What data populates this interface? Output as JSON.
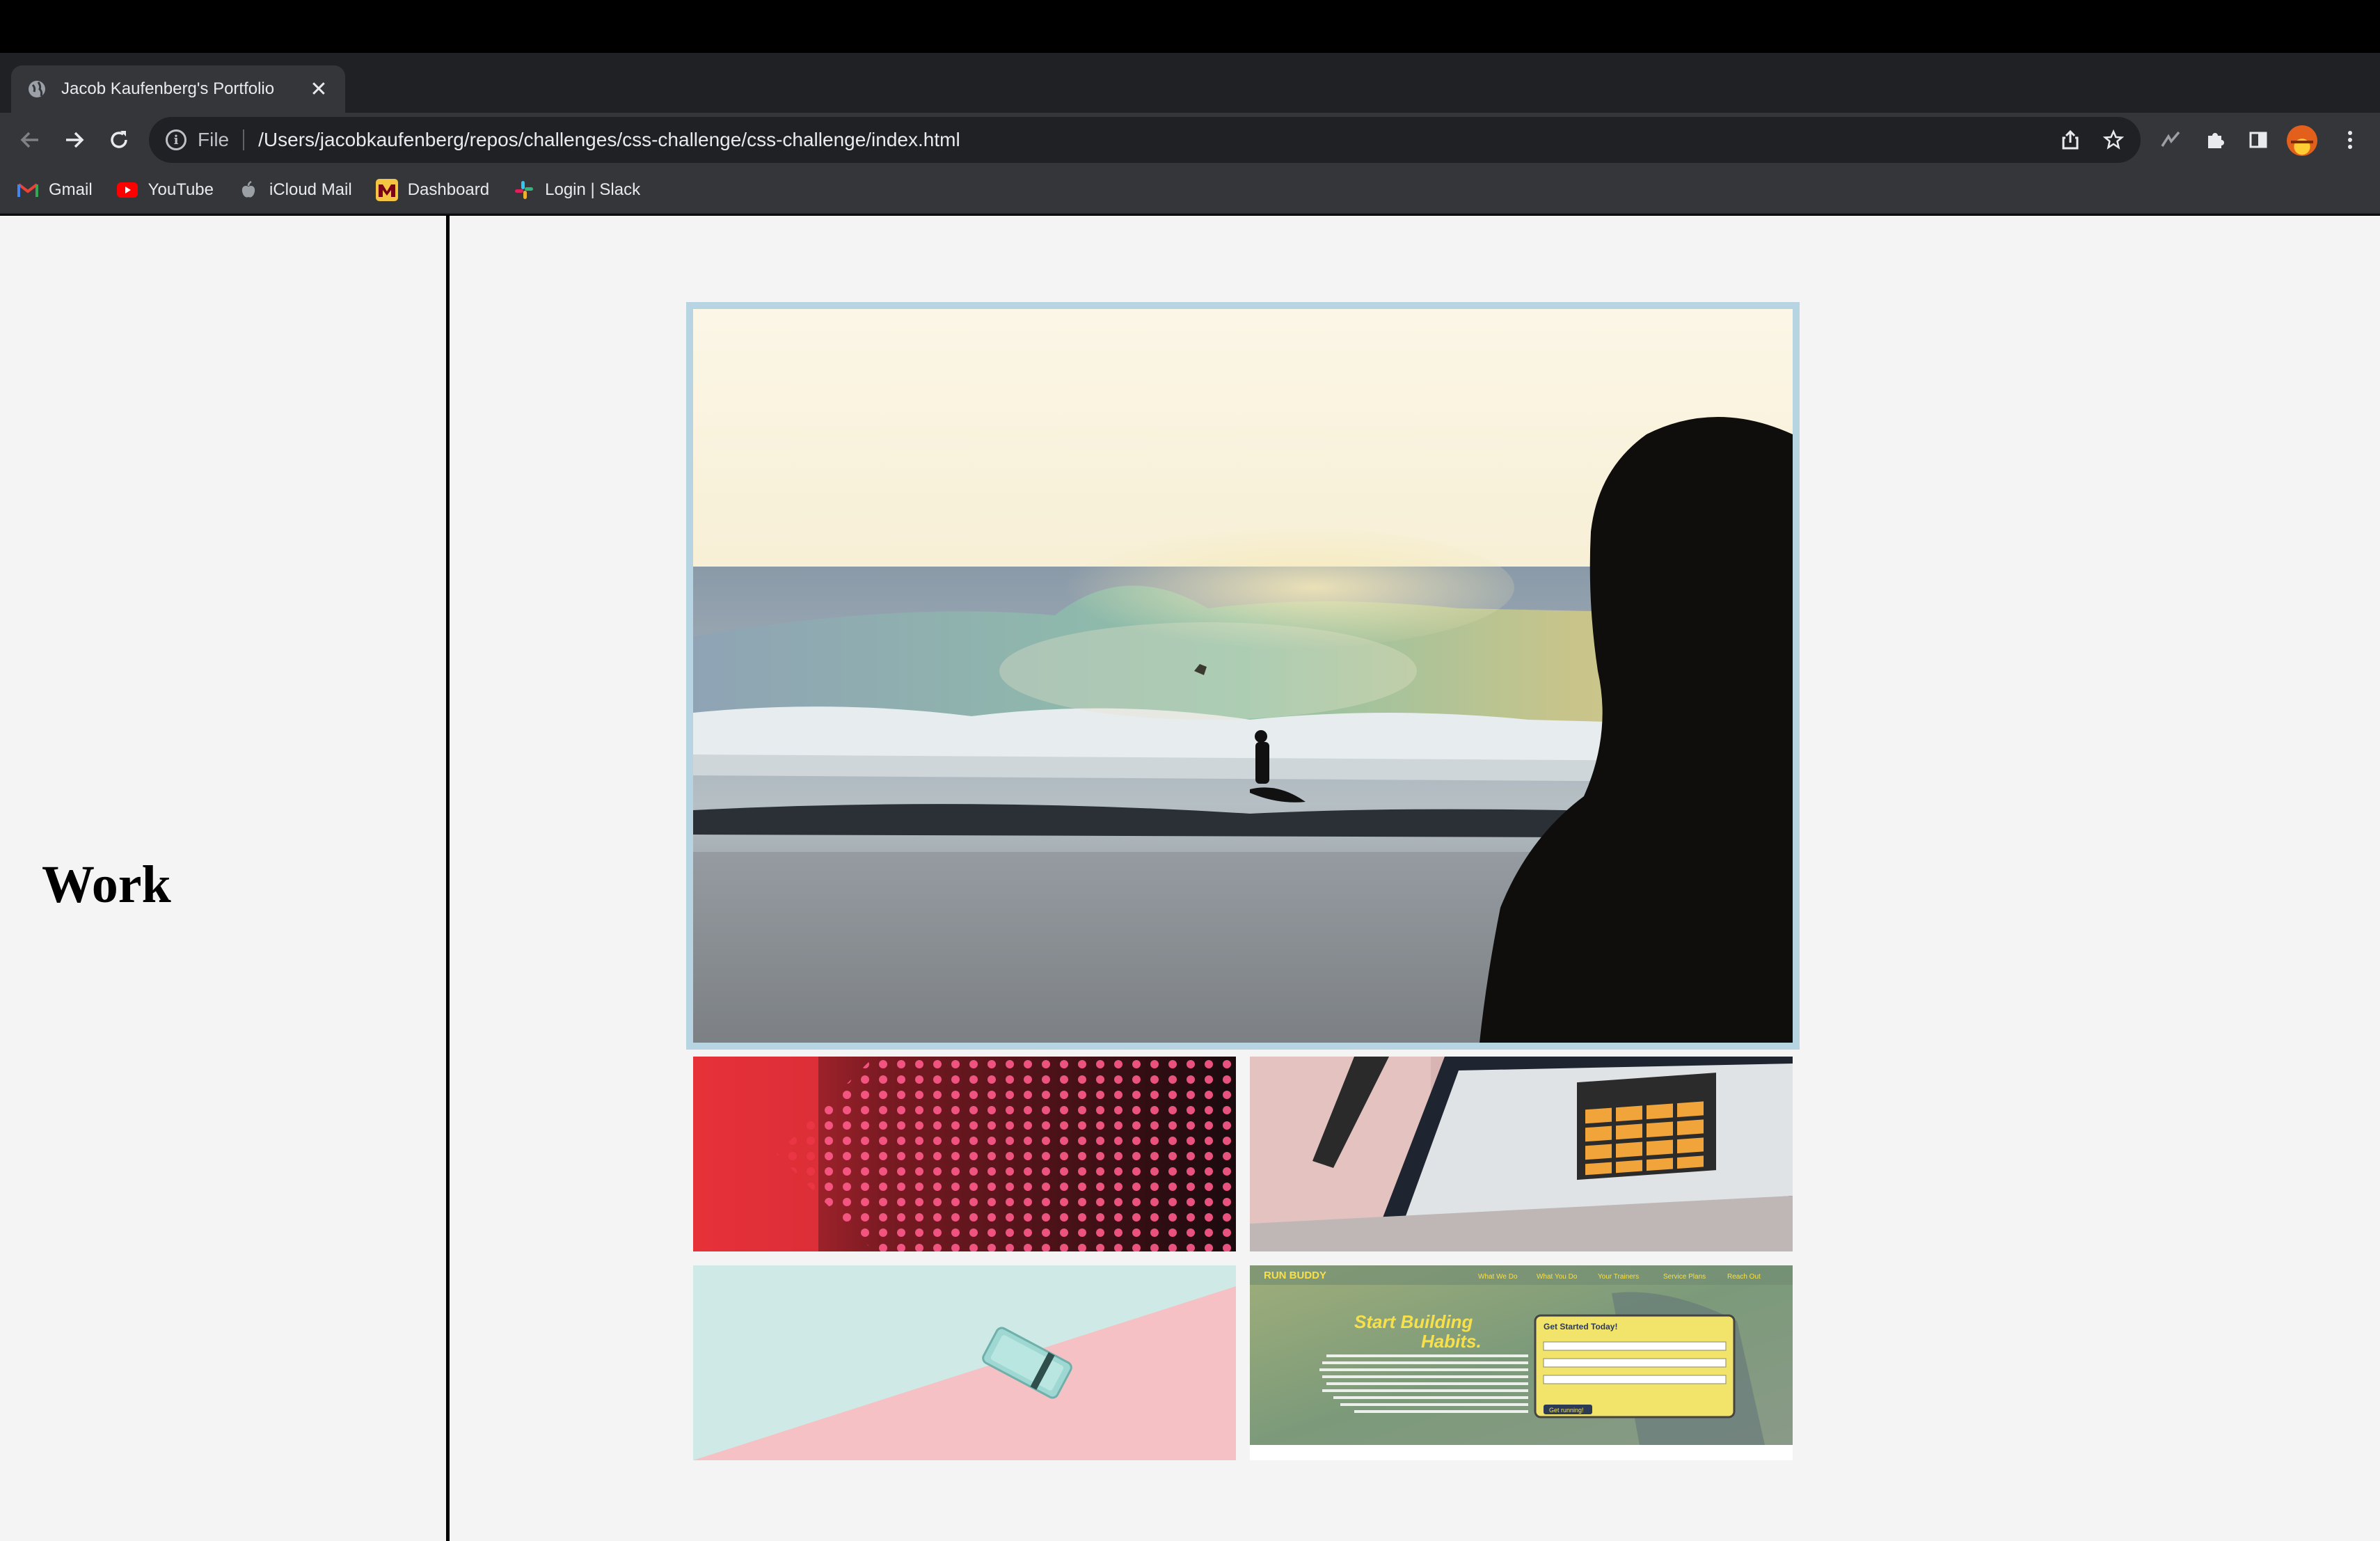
{
  "browser": {
    "tab_title": "Jacob Kaufenberg's Portfolio",
    "close_glyph": "✕",
    "new_tab_glyph": "+",
    "address_scheme": "File",
    "address_url": "/Users/jacobkaufenberg/repos/challenges/css-challenge/css-challenge/index.html"
  },
  "bookmarks": [
    {
      "label": "Gmail",
      "icon": "gmail-icon"
    },
    {
      "label": "YouTube",
      "icon": "youtube-icon"
    },
    {
      "label": "iCloud Mail",
      "icon": "apple-icon"
    },
    {
      "label": "Dashboard",
      "icon": "dashboard-icon"
    },
    {
      "label": "Login | Slack",
      "icon": "slack-icon"
    }
  ],
  "page": {
    "section_heading": "Work"
  },
  "run_buddy": {
    "brand": "RUN BUDDY",
    "nav": [
      "What We Do",
      "What You Do",
      "Your Trainers",
      "Service Plans",
      "Reach Out"
    ],
    "headline_1": "Start Building",
    "headline_2": "Habits.",
    "form_title": "Get Started Today!",
    "form_button": "Get running!"
  },
  "colors": {
    "hero_border": "#b7d4e2",
    "page_bg": "#f4f4f4",
    "chrome_dark": "#202124",
    "chrome_mid": "#35363a"
  }
}
